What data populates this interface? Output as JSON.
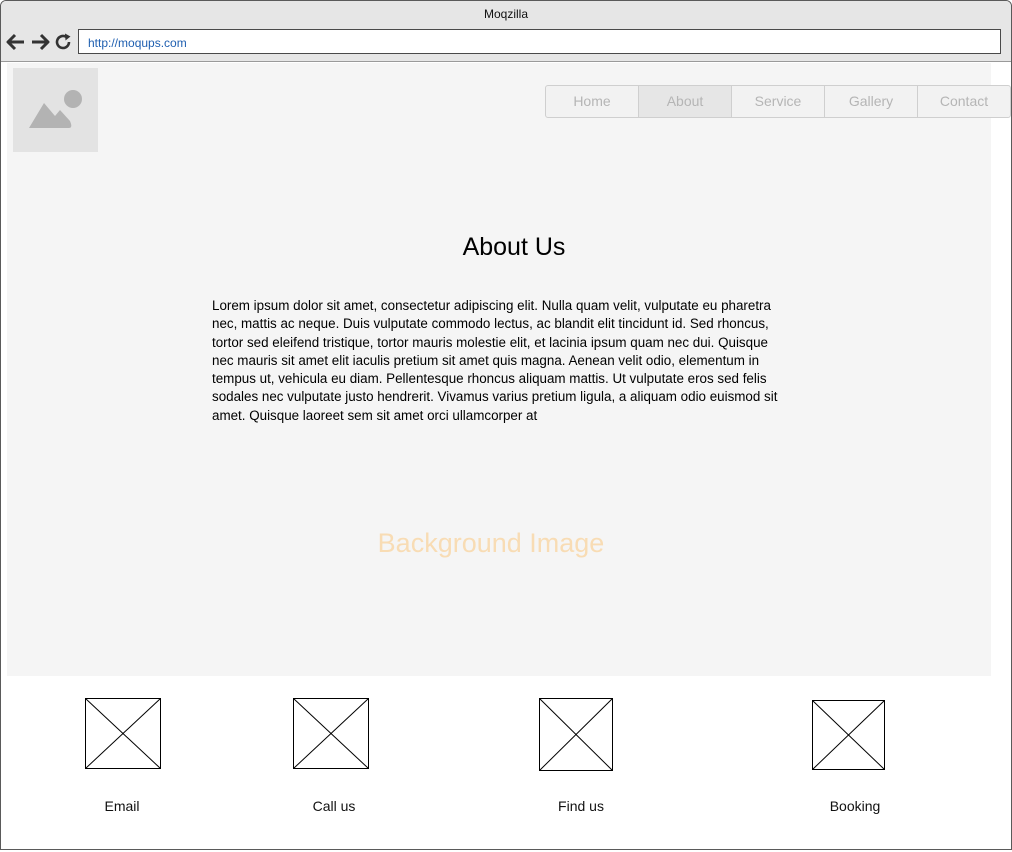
{
  "window": {
    "title": "Moqzilla"
  },
  "urlbar": {
    "url": "http://moqups.com"
  },
  "nav": {
    "back_icon": "arrow-left-icon",
    "forward_icon": "arrow-right-icon",
    "reload_icon": "reload-icon"
  },
  "logo": {
    "icon": "image-placeholder-icon"
  },
  "menu": {
    "items": [
      {
        "label": "Home"
      },
      {
        "label": "About",
        "active": true
      },
      {
        "label": "Service"
      },
      {
        "label": "Gallery"
      },
      {
        "label": "Contact"
      }
    ]
  },
  "about": {
    "heading": "About Us",
    "body": "Lorem ipsum dolor sit amet, consectetur adipiscing elit. Nulla quam velit, vulputate eu pharetra nec, mattis ac neque. Duis vulputate commodo lectus, ac blandit elit tincidunt id. Sed rhoncus, tortor sed eleifend tristique, tortor mauris molestie elit, et lacinia ipsum quam nec dui. Quisque nec mauris sit amet elit iaculis pretium sit amet quis magna. Aenean velit odio, elementum in tempus ut, vehicula eu diam. Pellentesque rhoncus aliquam mattis. Ut vulputate eros sed felis sodales nec vulputate justo hendrerit. Vivamus varius pretium ligula, a aliquam odio euismod sit amet. Quisque laoreet sem sit amet orci ullamcorper at"
  },
  "hero": {
    "background_label": "Background Image"
  },
  "features": [
    {
      "label": "Email"
    },
    {
      "label": "Call us"
    },
    {
      "label": "Find us"
    },
    {
      "label": "Booking"
    }
  ],
  "colors": {
    "chrome": "#e6e6e6",
    "hero_bg": "#f5f5f5",
    "url_text": "#1f5fb0",
    "bg_label": "#f8dcb4",
    "menu_text": "#b5b5b5"
  }
}
